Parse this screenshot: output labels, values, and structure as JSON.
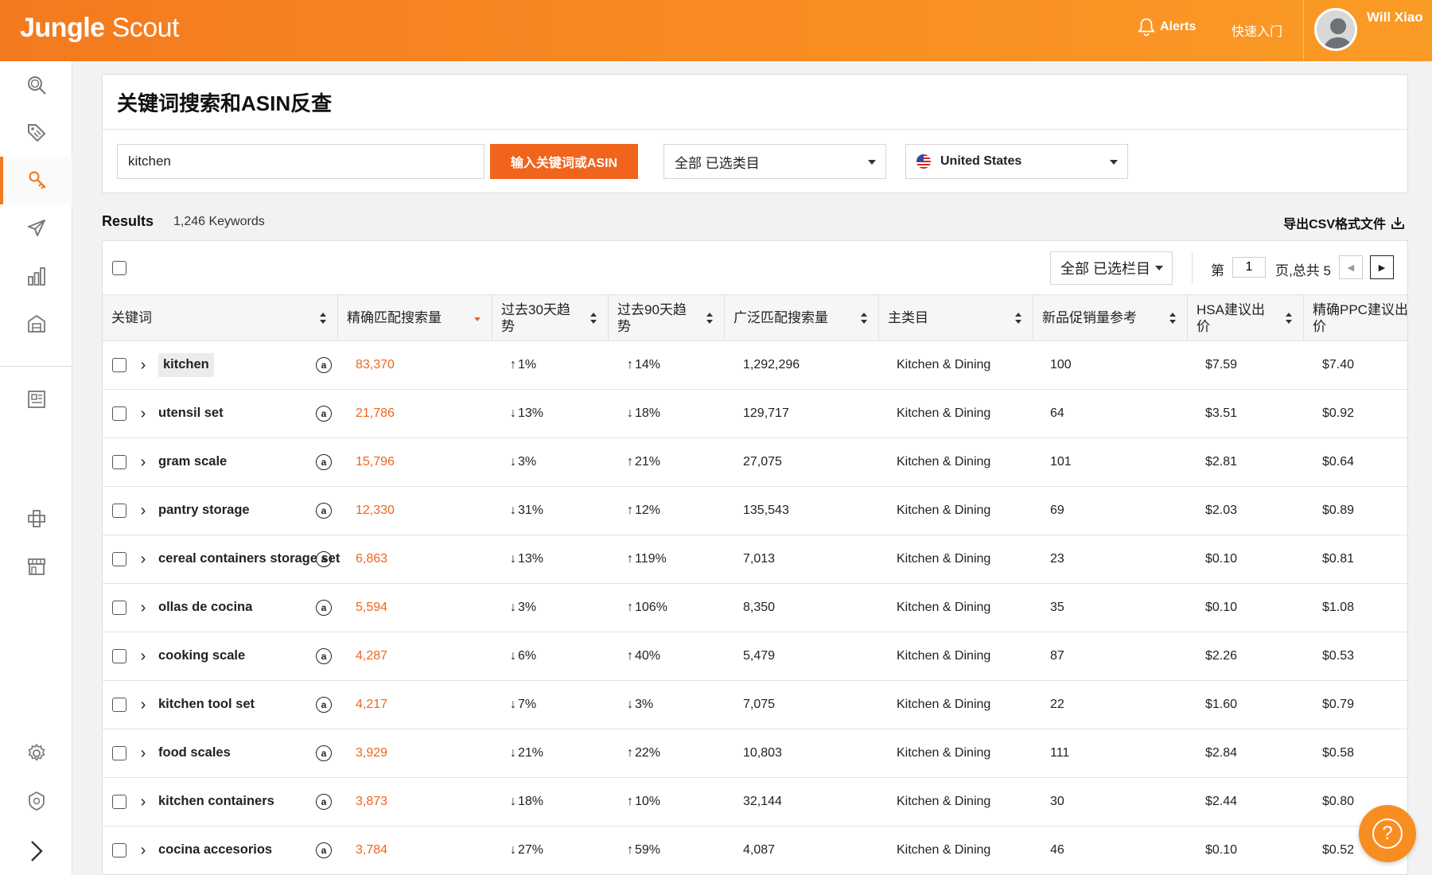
{
  "brand": {
    "logo_bold": "Jungle",
    "logo_light": " Scout",
    "accent": "#f47a1f",
    "button": "#f0641b"
  },
  "topbar": {
    "alerts_label": "Alerts",
    "quickstart_label": "快速入门",
    "username": "Will Xiao"
  },
  "sidebar": {
    "items": [
      {
        "icon": "search-icon"
      },
      {
        "icon": "tag-icon"
      },
      {
        "icon": "keyword-search-icon",
        "active": true
      },
      {
        "icon": "rocket-icon"
      },
      {
        "icon": "bar-chart-icon"
      },
      {
        "icon": "warehouse-icon"
      },
      {
        "icon": "news-icon"
      },
      {
        "icon": "puzzle-icon"
      },
      {
        "icon": "store-icon"
      },
      {
        "icon": "gear-icon"
      },
      {
        "icon": "shield-icon"
      },
      {
        "icon": "chevron-right-icon"
      }
    ]
  },
  "search": {
    "title": "关键词搜索和ASIN反查",
    "input_value": "kitchen",
    "button_label": "输入关键词或ASIN",
    "category_select": "全部 已选类目",
    "country_select": "United States"
  },
  "results": {
    "label": "Results",
    "count": "1,246 Keywords",
    "export_label": "导出CSV格式文件"
  },
  "toolbar": {
    "column_select": "全部 已选栏目",
    "page_prefix": "第",
    "page_value": "1",
    "page_suffix": "页,总共 5"
  },
  "columns": [
    "关键词",
    "精确匹配搜索量",
    "过去30天趋势",
    "过去90天趋势",
    "广泛匹配搜索量",
    "主类目",
    "新品促销量参考",
    "HSA建议出价",
    "精确PPC建议出价"
  ],
  "rows": [
    {
      "keyword": "kitchen",
      "exact": "83,370",
      "t30": {
        "dir": "up",
        "arrow": "↑",
        "val": "1%",
        "color": "neutral"
      },
      "t90": {
        "dir": "up",
        "arrow": "↑",
        "val": "14%",
        "color": "up"
      },
      "broad": "1,292,296",
      "category": "Kitchen & Dining",
      "promo": "100",
      "hsa": "$7.59",
      "ppc": "$7.40"
    },
    {
      "keyword": "utensil set",
      "exact": "21,786",
      "t30": {
        "arrow": "↓",
        "val": "13%",
        "color": "down"
      },
      "t90": {
        "arrow": "↓",
        "val": "18%",
        "color": "down"
      },
      "broad": "129,717",
      "category": "Kitchen & Dining",
      "promo": "64",
      "hsa": "$3.51",
      "ppc": "$0.92"
    },
    {
      "keyword": "gram scale",
      "exact": "15,796",
      "t30": {
        "arrow": "↓",
        "val": "3%",
        "color": "neutral"
      },
      "t90": {
        "arrow": "↑",
        "val": "21%",
        "color": "up"
      },
      "broad": "27,075",
      "category": "Kitchen & Dining",
      "promo": "101",
      "hsa": "$2.81",
      "ppc": "$0.64"
    },
    {
      "keyword": "pantry storage",
      "exact": "12,330",
      "t30": {
        "arrow": "↓",
        "val": "31%",
        "color": "down"
      },
      "t90": {
        "arrow": "↑",
        "val": "12%",
        "color": "up"
      },
      "broad": "135,543",
      "category": "Kitchen & Dining",
      "promo": "69",
      "hsa": "$2.03",
      "ppc": "$0.89"
    },
    {
      "keyword": "cereal containers storage set",
      "exact": "6,863",
      "t30": {
        "arrow": "↓",
        "val": "13%",
        "color": "down"
      },
      "t90": {
        "arrow": "↑",
        "val": "119%",
        "color": "up"
      },
      "broad": "7,013",
      "category": "Kitchen & Dining",
      "promo": "23",
      "hsa": "$0.10",
      "ppc": "$0.81"
    },
    {
      "keyword": "ollas de cocina",
      "exact": "5,594",
      "t30": {
        "arrow": "↓",
        "val": "3%",
        "color": "neutral"
      },
      "t90": {
        "arrow": "↑",
        "val": "106%",
        "color": "up"
      },
      "broad": "8,350",
      "category": "Kitchen & Dining",
      "promo": "35",
      "hsa": "$0.10",
      "ppc": "$1.08"
    },
    {
      "keyword": "cooking scale",
      "exact": "4,287",
      "t30": {
        "arrow": "↓",
        "val": "6%",
        "color": "down"
      },
      "t90": {
        "arrow": "↑",
        "val": "40%",
        "color": "up"
      },
      "broad": "5,479",
      "category": "Kitchen & Dining",
      "promo": "87",
      "hsa": "$2.26",
      "ppc": "$0.53"
    },
    {
      "keyword": "kitchen tool set",
      "exact": "4,217",
      "t30": {
        "arrow": "↓",
        "val": "7%",
        "color": "down"
      },
      "t90": {
        "arrow": "↓",
        "val": "3%",
        "color": "neutral"
      },
      "broad": "7,075",
      "category": "Kitchen & Dining",
      "promo": "22",
      "hsa": "$1.60",
      "ppc": "$0.79"
    },
    {
      "keyword": "food scales",
      "exact": "3,929",
      "t30": {
        "arrow": "↓",
        "val": "21%",
        "color": "down"
      },
      "t90": {
        "arrow": "↑",
        "val": "22%",
        "color": "up"
      },
      "broad": "10,803",
      "category": "Kitchen & Dining",
      "promo": "111",
      "hsa": "$2.84",
      "ppc": "$0.58"
    },
    {
      "keyword": "kitchen containers",
      "exact": "3,873",
      "t30": {
        "arrow": "↓",
        "val": "18%",
        "color": "down"
      },
      "t90": {
        "arrow": "↑",
        "val": "10%",
        "color": "up"
      },
      "broad": "32,144",
      "category": "Kitchen & Dining",
      "promo": "30",
      "hsa": "$2.44",
      "ppc": "$0.80"
    },
    {
      "keyword": "cocina accesorios",
      "exact": "3,784",
      "t30": {
        "arrow": "↓",
        "val": "27%",
        "color": "down"
      },
      "t90": {
        "arrow": "↑",
        "val": "59%",
        "color": "up"
      },
      "broad": "4,087",
      "category": "Kitchen & Dining",
      "promo": "46",
      "hsa": "$0.10",
      "ppc": "$0.52"
    }
  ],
  "help": {
    "icon": "help-icon",
    "label": "?"
  }
}
